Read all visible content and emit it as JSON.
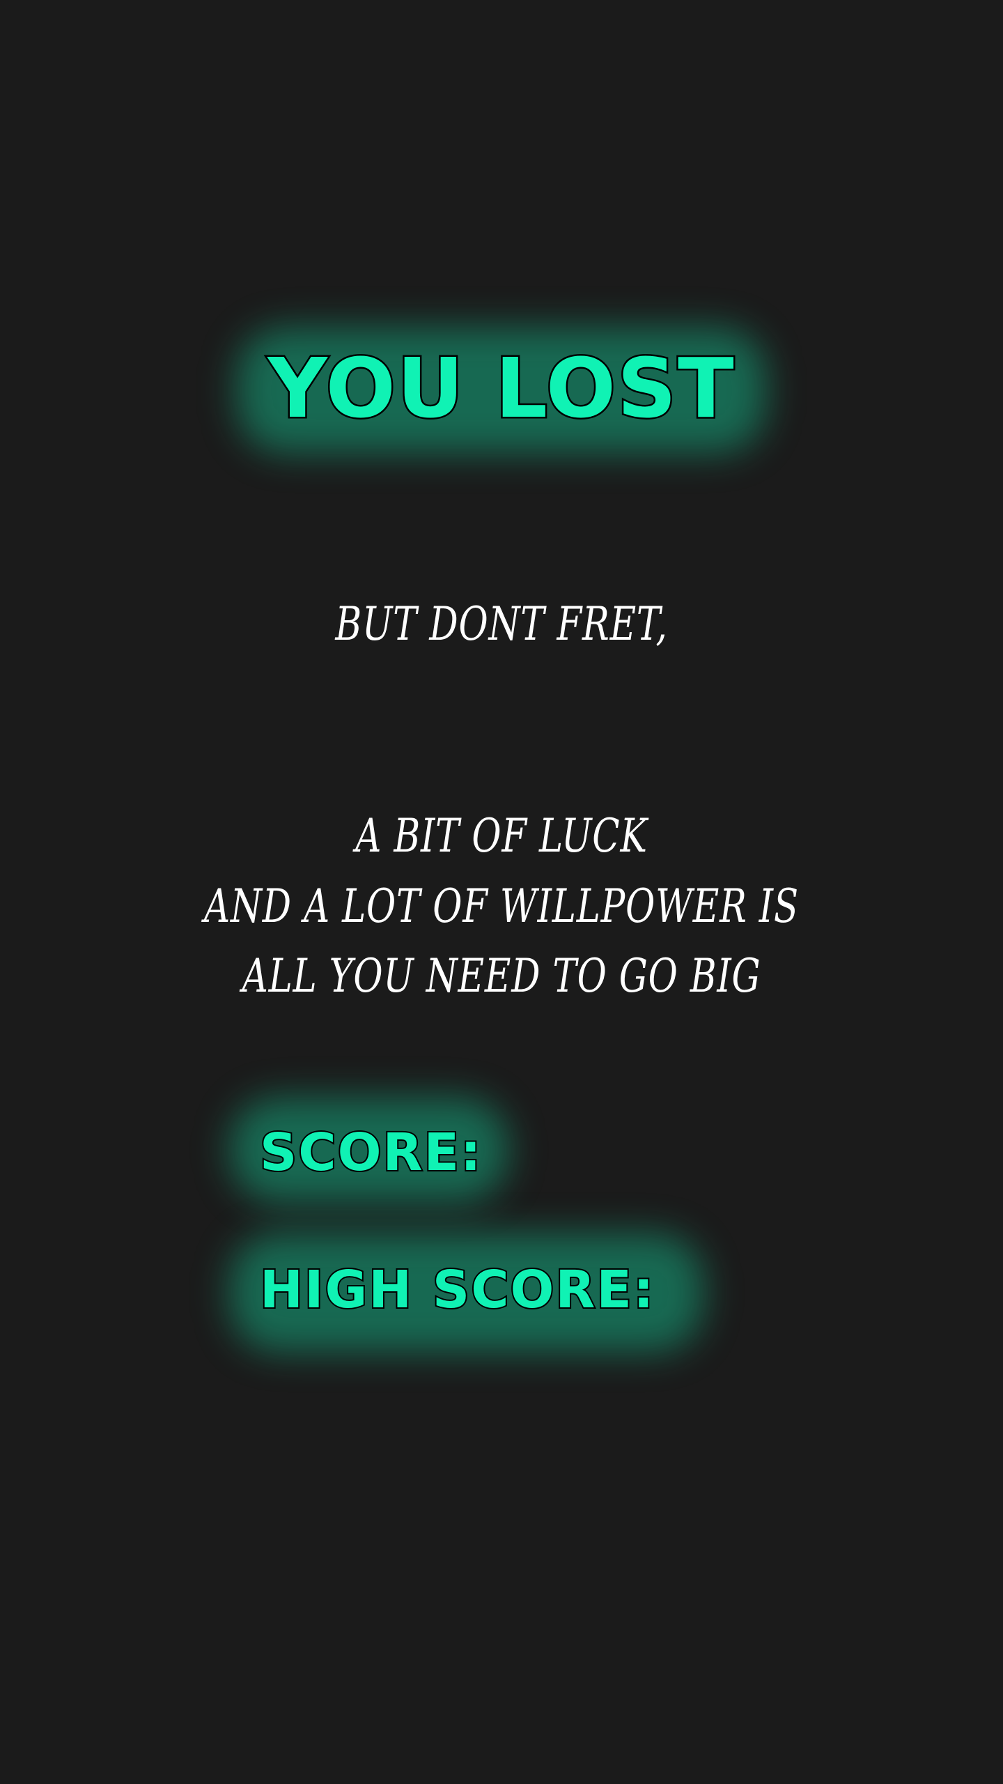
{
  "screen": {
    "title": "YOU LOST",
    "subtitle": "BUT DONT FRET,",
    "message_lines": [
      "A BIT OF LUCK",
      "AND A LOT OF WILLPOWER IS",
      "ALL YOU NEED TO GO BIG"
    ],
    "score_label": "SCORE:",
    "high_score_label": "HIGH SCORE:"
  },
  "colors": {
    "background": "#1b1b1b",
    "accent": "#10f2b4",
    "text": "#ffffff",
    "outline": "#000000"
  }
}
